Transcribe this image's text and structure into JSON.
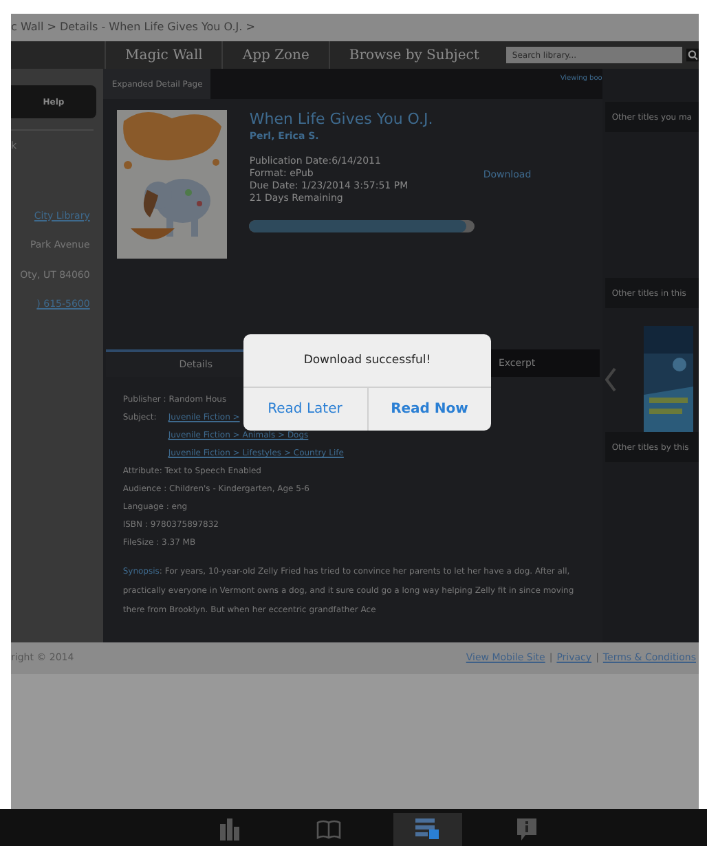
{
  "breadcrumb": "c Wall > Details - When Life Gives You O.J. >",
  "nav": {
    "items": [
      "Magic Wall",
      "App Zone",
      "Browse by Subject"
    ],
    "search": {
      "placeholder": "Search library..."
    }
  },
  "sidebar": {
    "help": "Help",
    "link": "k",
    "address": [
      {
        "text": "City Library",
        "kind": "link"
      },
      {
        "text": "Park Avenue",
        "kind": "plain"
      },
      {
        "text": "Oty, UT 84060",
        "kind": "plain"
      },
      {
        "text": ") 615-5600",
        "kind": "link"
      }
    ]
  },
  "page_tab": "Expanded Detail Page",
  "viewing": "Viewing boo",
  "book": {
    "title": "When Life Gives You O.J.",
    "author": "Perl, Erica S.",
    "publication": "Publication Date:6/14/2011",
    "format": "Format: ePub",
    "due": "Due Date: 1/23/2014 3:57:51 PM",
    "remaining": "21 Days Remaining",
    "download": "Download",
    "level": 0.96
  },
  "tabs": [
    {
      "label": "Details",
      "selected": true
    },
    {
      "label": "Excerpt",
      "selected": false
    }
  ],
  "details": [
    {
      "label": "Publisher : Random Hous",
      "kind": "plain"
    },
    {
      "label": "Subject:",
      "links": [
        "Juvenile Fiction >",
        "Juvenile Fiction > Animals > Dogs",
        "Juvenile Fiction > Lifestyles > Country Life"
      ],
      "kind": "subject"
    },
    {
      "label": "Attribute: Text to Speech Enabled",
      "kind": "plain"
    },
    {
      "label": "Audience : Children's - Kindergarten, Age 5-6",
      "kind": "plain"
    },
    {
      "label": "Language : eng",
      "kind": "plain"
    },
    {
      "label": "ISBN : 9780375897832",
      "kind": "plain"
    },
    {
      "label": "FileSize : 3.37 MB",
      "kind": "plain"
    }
  ],
  "synopsis": {
    "label": "Synopsis",
    "text": ": For years, 10-year-old Zelly Fried has tried to convince her parents to let her have a dog. After all, practically everyone in Vermont owns a dog, and it sure could go a long way helping Zelly fit in since moving there from Brooklyn. But when her eccentric grandfather Ace"
  },
  "right": {
    "sections": [
      "Other titles you ma",
      "Other titles in this",
      "Other titles by this"
    ]
  },
  "footer": {
    "copyright": "right © 2014",
    "links": [
      "View Mobile Site",
      "Privacy",
      "Terms & Conditions"
    ],
    "separator": "|"
  },
  "dialog": {
    "message": "Download successful!",
    "buttons": [
      "Read Later",
      "Read Now"
    ]
  },
  "tabbar": [
    {
      "kind": "stats",
      "selected": false
    },
    {
      "kind": "book",
      "selected": false
    },
    {
      "kind": "download",
      "selected": true
    },
    {
      "kind": "info",
      "selected": false
    }
  ]
}
